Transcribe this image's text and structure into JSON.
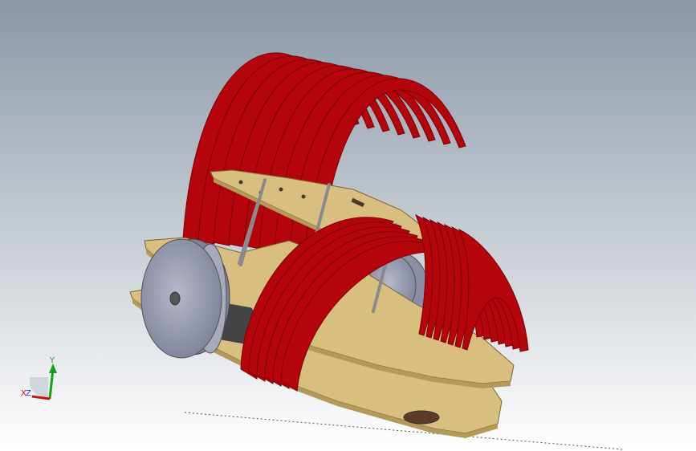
{
  "viewport": {
    "background_top": "#8a97a6",
    "background_bottom": "#ffffff"
  },
  "model": {
    "plate_color": "#d8bf80",
    "plate_edge_color": "#b49a58",
    "fin_color": "#b3050b",
    "fin_dark_color": "#7d0206",
    "wheel_color": "#9ea1b4",
    "wheel_rim_color": "#6d7188",
    "standoff_color": "#8a8a8a",
    "motor_color": "#444447"
  },
  "triad": {
    "y_label": "Y",
    "x_label": "X",
    "z_label": "Z",
    "y_color": "#15a015",
    "x_color": "#d01010",
    "z_color": "#1a3ad8"
  }
}
